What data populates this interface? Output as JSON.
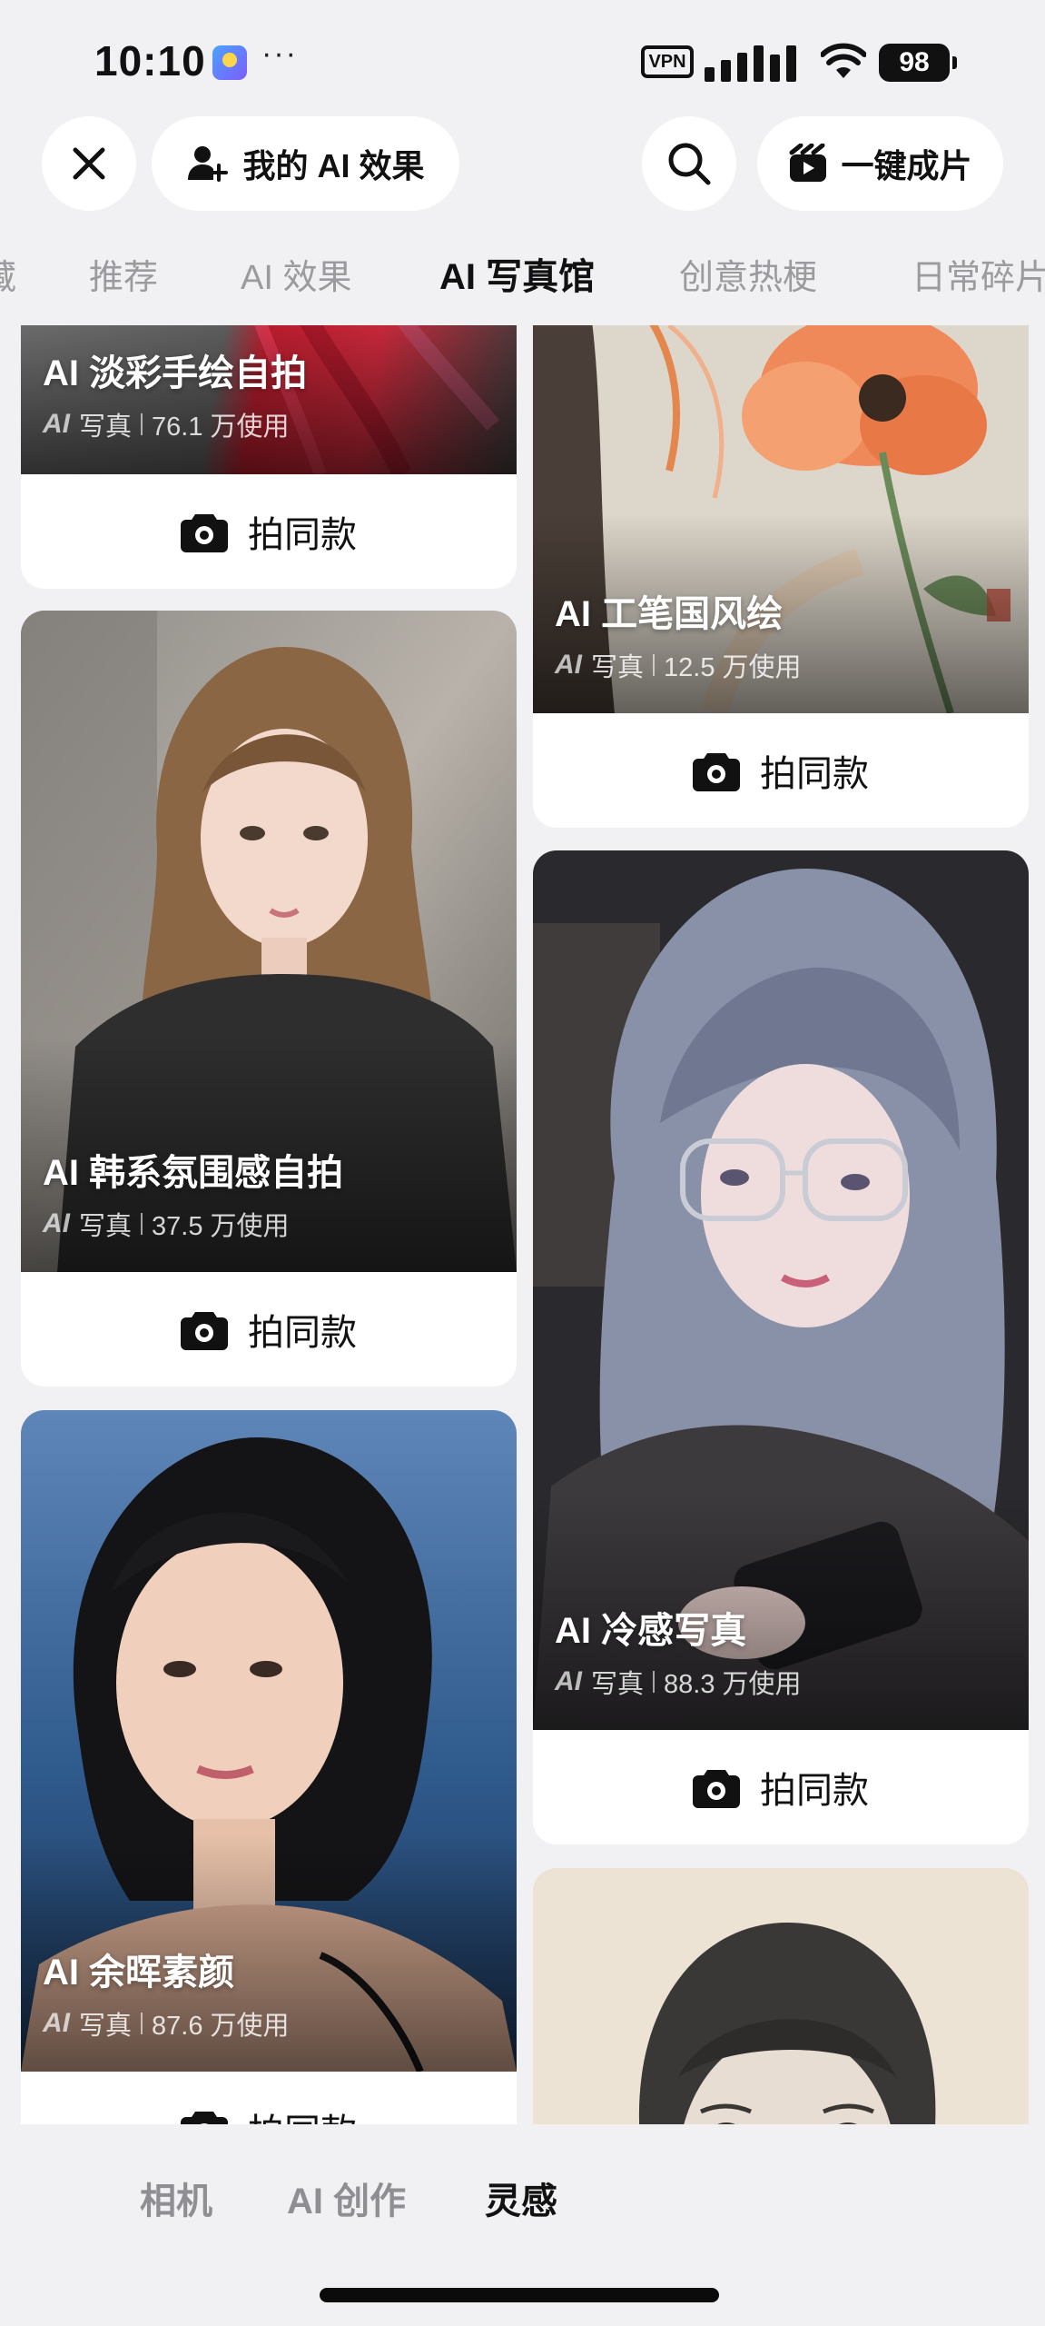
{
  "status_bar": {
    "time": "10:10",
    "dots": "···",
    "vpn": "VPN",
    "battery": "98"
  },
  "top_bar": {
    "my_ai_label": "我的 AI 效果",
    "one_click_label": "一键成片"
  },
  "tabs": [
    {
      "label": "藏"
    },
    {
      "label": "推荐"
    },
    {
      "label": "AI 效果"
    },
    {
      "label": "AI 写真馆",
      "active": true
    },
    {
      "label": "创意热梗"
    },
    {
      "label": "日常碎片"
    }
  ],
  "cards": [
    {
      "title": "AI 淡彩手绘自拍",
      "tag": "AI",
      "category": "写真",
      "usage": "76.1 万使用",
      "button": "拍同款"
    },
    {
      "title": "AI 工笔国风绘",
      "tag": "AI",
      "category": "写真",
      "usage": "12.5 万使用",
      "button": "拍同款"
    },
    {
      "title": "AI 韩系氛围感自拍",
      "tag": "AI",
      "category": "写真",
      "usage": "37.5 万使用",
      "button": "拍同款"
    },
    {
      "title": "AI 冷感写真",
      "tag": "AI",
      "category": "写真",
      "usage": "88.3 万使用",
      "button": "拍同款"
    },
    {
      "title": "AI 余晖素颜",
      "tag": "AI",
      "category": "写真",
      "usage": "87.6 万使用",
      "button": "拍同款"
    }
  ],
  "bottom_nav": [
    {
      "label": "相机"
    },
    {
      "label": "AI 创作"
    },
    {
      "label": "灵感",
      "active": true
    }
  ],
  "colors": {
    "background": "#f1f1f3",
    "card": "#ffffff",
    "text_primary": "#111111",
    "text_muted": "#9a9a9f"
  },
  "icons": [
    "close-icon",
    "add-user-icon",
    "search-icon",
    "clapper-icon",
    "camera-icon"
  ]
}
